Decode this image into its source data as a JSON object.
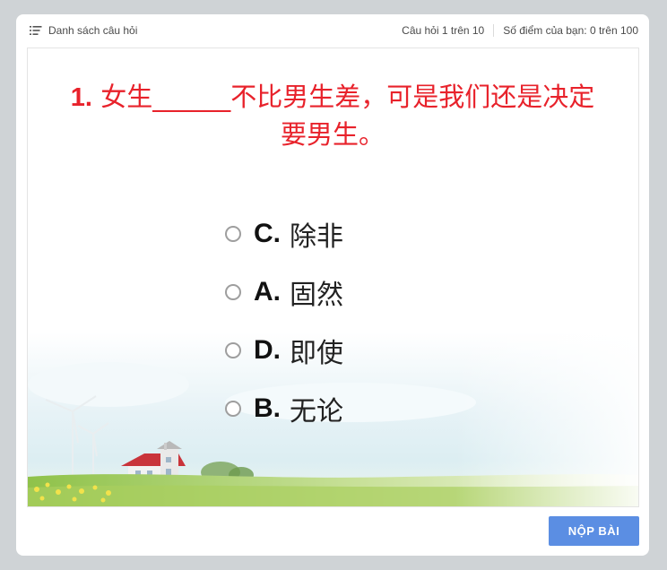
{
  "header": {
    "question_list_label": "Danh sách câu hỏi",
    "question_counter": "Câu hỏi 1 trên 10",
    "score_label": "Số điểm của bạn: 0 trên 100"
  },
  "question": {
    "number": "1.",
    "text": "女生______不比男生差，可是我们还是决定要男生。"
  },
  "options": [
    {
      "letter": "C.",
      "text": "除非"
    },
    {
      "letter": "A.",
      "text": "固然"
    },
    {
      "letter": "D.",
      "text": "即使"
    },
    {
      "letter": "B.",
      "text": "无论"
    }
  ],
  "footer": {
    "submit_label": "NỘP BÀI"
  },
  "colors": {
    "question_text": "#e8222b",
    "submit_button": "#5b8ee3",
    "page_background": "#cfd3d6"
  },
  "icons": {
    "question_list": "list-icon"
  }
}
